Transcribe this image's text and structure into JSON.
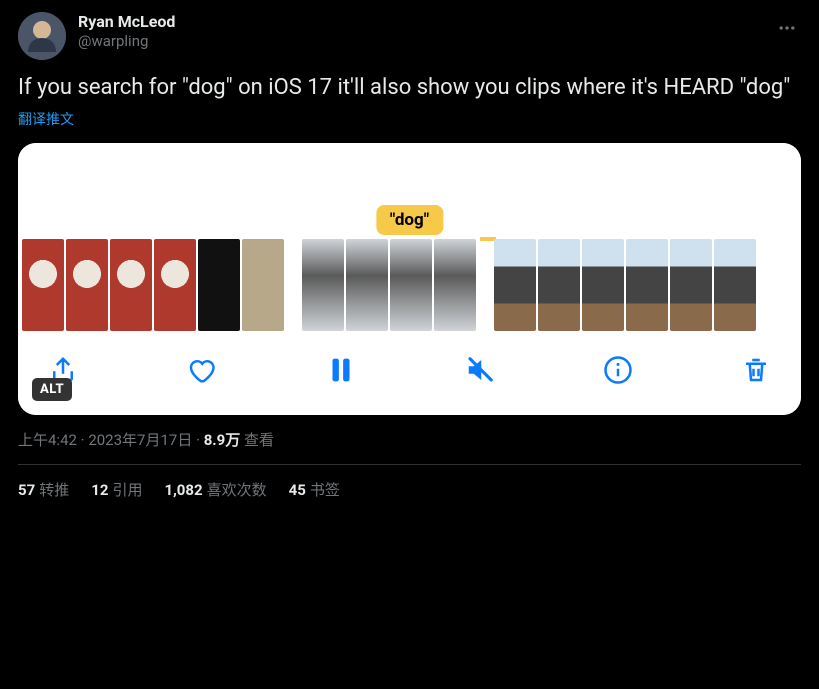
{
  "tweet": {
    "author": {
      "display_name": "Ryan McLeod",
      "handle": "@warpling"
    },
    "text": "If you search for \"dog\" on iOS 17 it'll also show you clips where it's HEARD \"dog\"",
    "translate_label": "翻译推文",
    "media": {
      "caption_badge": "\"dog\"",
      "alt_badge": "ALT",
      "toolbar": {
        "share": "share",
        "like": "like",
        "pause": "pause",
        "mute": "mute",
        "info": "info",
        "delete": "delete"
      }
    },
    "meta": {
      "time": "上午4:42",
      "date": "2023年7月17日",
      "views_count": "8.9万",
      "views_label": "查看"
    },
    "stats": {
      "retweets": {
        "count": "57",
        "label": "转推"
      },
      "quotes": {
        "count": "12",
        "label": "引用"
      },
      "likes": {
        "count": "1,082",
        "label": "喜欢次数"
      },
      "bookmarks": {
        "count": "45",
        "label": "书签"
      }
    }
  }
}
